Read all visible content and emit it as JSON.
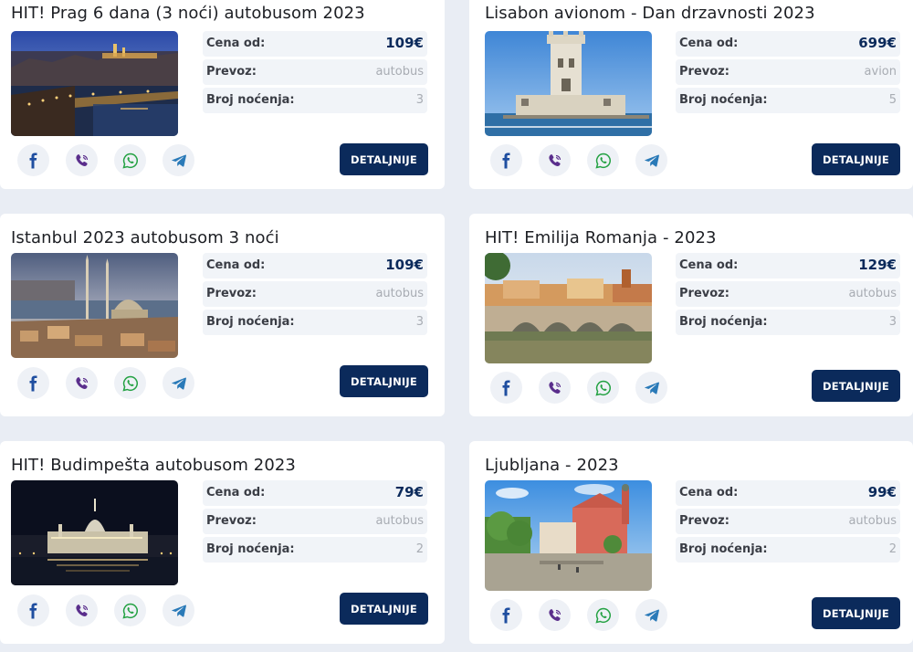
{
  "labels": {
    "price": "Cena od:",
    "transport": "Prevoz:",
    "nights": "Broj noćenja:",
    "details_button": "DETALJNIJE"
  },
  "share_icons": [
    "facebook-icon",
    "viber-icon",
    "whatsapp-icon",
    "telegram-icon"
  ],
  "colors": {
    "page_background": "#e9edf4",
    "card_background": "#ffffff",
    "row_background": "#f1f4f8",
    "accent_navy": "#0b2a5b",
    "muted_value": "#a8acb3",
    "icon_facebook": "#1f4ea0",
    "icon_viber": "#5a2e8c",
    "icon_whatsapp": "#25a244",
    "icon_telegram": "#2a7ab8"
  },
  "offers": [
    {
      "title": "HIT! Prag 6 dana (3 noći) autobusom 2023",
      "price": "109€",
      "transport": "autobus",
      "nights": "3",
      "photo": "prague-night-photo"
    },
    {
      "title": "Lisabon avionom - Dan drzavnosti 2023",
      "price": "699€",
      "transport": "avion",
      "nights": "5",
      "photo": "belem-tower-photo"
    },
    {
      "title": "Istanbul 2023 autobusom 3 noći",
      "price": "109€",
      "transport": "autobus",
      "nights": "3",
      "photo": "istanbul-mosque-photo"
    },
    {
      "title": "HIT! Emilija Romanja - 2023",
      "price": "129€",
      "transport": "autobus",
      "nights": "3",
      "photo": "rimini-bridge-photo"
    },
    {
      "title": "HIT! Budimpešta autobusom 2023",
      "price": "79€",
      "transport": "autobus",
      "nights": "2",
      "photo": "budapest-parliament-photo"
    },
    {
      "title": "Ljubljana - 2023",
      "price": "99€",
      "transport": "autobus",
      "nights": "2",
      "photo": "ljubljana-church-photo"
    }
  ]
}
